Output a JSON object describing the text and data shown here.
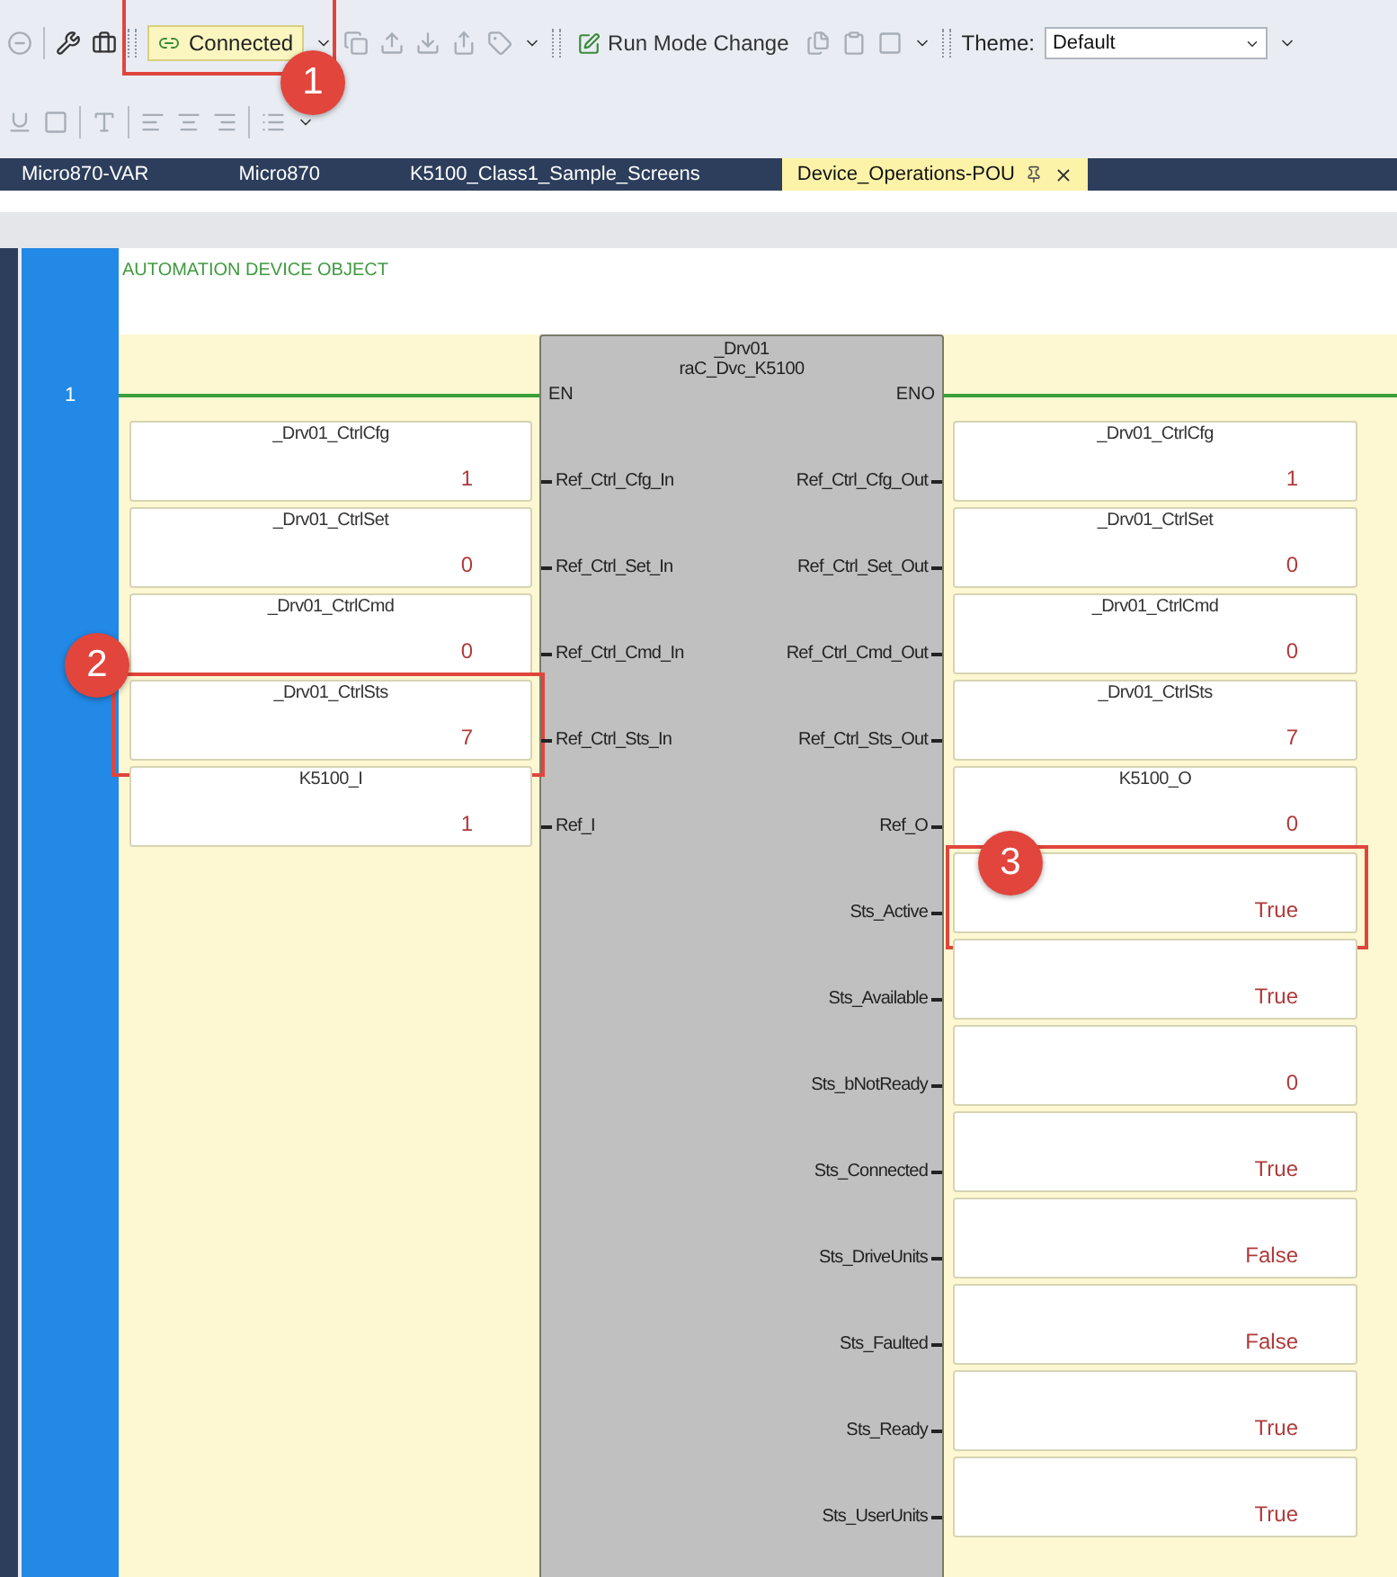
{
  "toolbar": {
    "connection_status": "Connected",
    "connection_callout": "1",
    "run_mode_button": "Run Mode Change",
    "theme_label": "Theme:",
    "theme_value": "Default"
  },
  "tabs": [
    {
      "label": "Micro870-VAR",
      "selected": false
    },
    {
      "label": "Micro870",
      "selected": false
    },
    {
      "label": "K5100_Class1_Sample_Screens",
      "selected": false
    },
    {
      "label": "Device_Operations-POU",
      "selected": true
    }
  ],
  "rung": {
    "number": "1",
    "comment": "AUTOMATION DEVICE OBJECT"
  },
  "block": {
    "instance": "_Drv01",
    "type": "raC_Dvc_K5100",
    "en": "EN",
    "eno": "ENO"
  },
  "inputs": [
    {
      "pin": "Ref_Ctrl_Cfg_In",
      "variable": "_Drv01_CtrlCfg",
      "value": "1"
    },
    {
      "pin": "Ref_Ctrl_Set_In",
      "variable": "_Drv01_CtrlSet",
      "value": "0"
    },
    {
      "pin": "Ref_Ctrl_Cmd_In",
      "variable": "_Drv01_CtrlCmd",
      "value": "0"
    },
    {
      "pin": "Ref_Ctrl_Sts_In",
      "variable": "_Drv01_CtrlSts",
      "value": "7",
      "callout": "2"
    },
    {
      "pin": "Ref_I",
      "variable": "K5100_I",
      "value": "1"
    }
  ],
  "outputs": [
    {
      "pin": "Ref_Ctrl_Cfg_Out",
      "variable": "_Drv01_CtrlCfg",
      "value": "1"
    },
    {
      "pin": "Ref_Ctrl_Set_Out",
      "variable": "_Drv01_CtrlSet",
      "value": "0"
    },
    {
      "pin": "Ref_Ctrl_Cmd_Out",
      "variable": "_Drv01_CtrlCmd",
      "value": "0"
    },
    {
      "pin": "Ref_Ctrl_Sts_Out",
      "variable": "_Drv01_CtrlSts",
      "value": "7"
    },
    {
      "pin": "Ref_O",
      "variable": "K5100_O",
      "value": "0"
    },
    {
      "pin": "Sts_Active",
      "value": "True",
      "callout": "3"
    },
    {
      "pin": "Sts_Available",
      "value": "True"
    },
    {
      "pin": "Sts_bNotReady",
      "value": "0"
    },
    {
      "pin": "Sts_Connected",
      "value": "True"
    },
    {
      "pin": "Sts_DriveUnits",
      "value": "False"
    },
    {
      "pin": "Sts_Faulted",
      "value": "False"
    },
    {
      "pin": "Sts_Ready",
      "value": "True"
    },
    {
      "pin": "Sts_UserUnits",
      "value": "True"
    }
  ]
}
